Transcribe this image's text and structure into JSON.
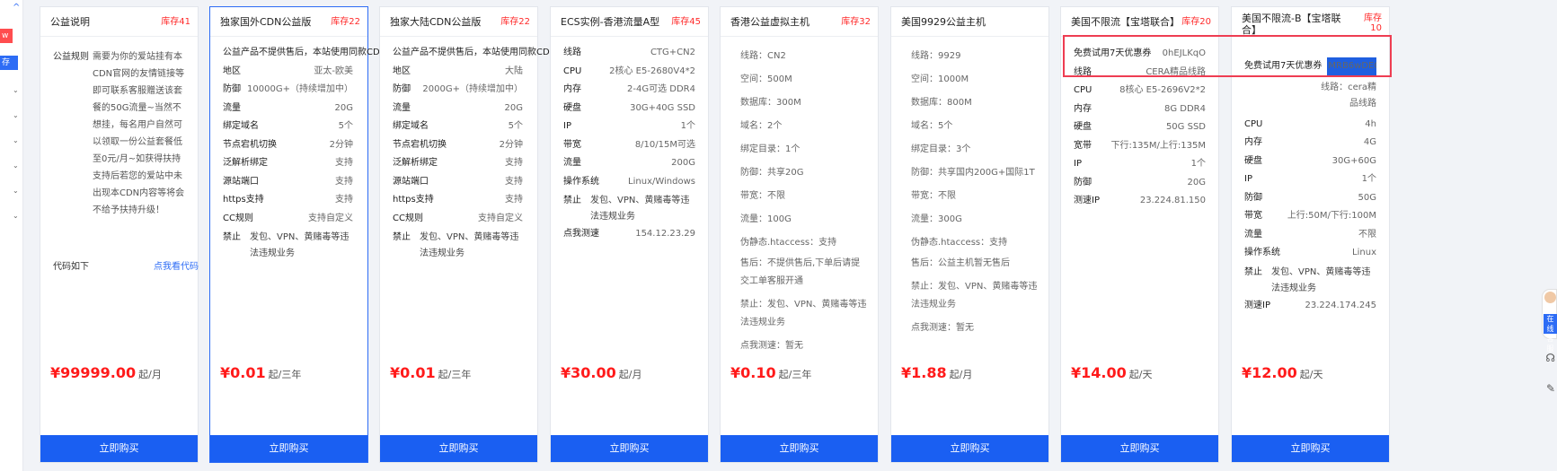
{
  "sidebar": {
    "top_label": "^",
    "tag_red": "w",
    "tag_blue": "存",
    "arrows": [
      "⌄",
      "⌄",
      "⌄",
      "⌄",
      "⌄",
      "⌄"
    ]
  },
  "cards": [
    {
      "title": "公益说明",
      "stock": "库存41",
      "price": "¥99999.00",
      "unit": "起/月",
      "buy": "立即购买",
      "note": {
        "label": "公益规则",
        "text": "需要为你的爱站挂有本CDN官网的友情链接等即可联系客服赠送该套餐的50G流量~当然不想挂，每名用户自然可以领取一份公益套餐低至0元/月~如获得扶持支持后若您的爱站中未出现本CDN内容等将会不给予扶持升级！",
        "code_label": "代码如下",
        "code_link": "点我看代码"
      }
    },
    {
      "title": "独家国外CDN公益版",
      "stock": "库存22",
      "price": "¥0.01",
      "unit": "起/三年",
      "buy": "立即购买",
      "rows": [
        [
          "公益产品不提供售后，本站使用同款CDN，",
          ""
        ],
        [
          "地区",
          "亚太-欧美"
        ],
        [
          "防御",
          "10000G+（持续增加中）"
        ],
        [
          "流量",
          "20G"
        ],
        [
          "绑定域名",
          "5个"
        ],
        [
          "节点宕机切换",
          "2分钟"
        ],
        [
          "泛解析绑定",
          "支持"
        ],
        [
          "源站端口",
          "支持"
        ],
        [
          "https支持",
          "支持"
        ],
        [
          "CC规则",
          "支持自定义"
        ]
      ],
      "wrap": {
        "k": "禁止",
        "v": "发包、VPN、黄赌毒等违法违规业务"
      }
    },
    {
      "title": "独家大陆CDN公益版",
      "stock": "库存22",
      "price": "¥0.01",
      "unit": "起/三年",
      "buy": "立即购买",
      "rows": [
        [
          "公益产品不提供售后，本站使用同款CDN，",
          ""
        ],
        [
          "地区",
          "大陆"
        ],
        [
          "防御",
          "2000G+（持续增加中）"
        ],
        [
          "流量",
          "20G"
        ],
        [
          "绑定域名",
          "5个"
        ],
        [
          "节点宕机切换",
          "2分钟"
        ],
        [
          "泛解析绑定",
          "支持"
        ],
        [
          "源站端口",
          "支持"
        ],
        [
          "https支持",
          "支持"
        ],
        [
          "CC规则",
          "支持自定义"
        ]
      ],
      "wrap": {
        "k": "禁止",
        "v": "发包、VPN、黄赌毒等违法违规业务"
      }
    },
    {
      "title": "ECS实例-香港流量A型",
      "stock": "库存45",
      "price": "¥30.00",
      "unit": "起/月",
      "buy": "立即购买",
      "rows": [
        [
          "线路",
          "CTG+CN2"
        ],
        [
          "CPU",
          "2核心 E5-2680V4*2"
        ],
        [
          "内存",
          "2-4G可选 DDR4"
        ],
        [
          "硬盘",
          "30G+40G SSD"
        ],
        [
          "IP",
          "1个"
        ],
        [
          "带宽",
          "8/10/15M可选"
        ],
        [
          "流量",
          "200G"
        ],
        [
          "操作系统",
          "Linux/Windows"
        ]
      ],
      "wrap": {
        "k": "禁止",
        "v": "发包、VPN、黄赌毒等违法违规业务"
      },
      "tail": [
        "点我测速",
        "154.12.23.29"
      ]
    },
    {
      "title": "香港公益虚拟主机",
      "stock": "库存32",
      "price": "¥0.10",
      "unit": "起/三年",
      "buy": "立即购买",
      "plain": [
        "线路：CN2",
        "空间：500M",
        "数据库：300M",
        "域名：2个",
        "绑定目录：1个",
        "防御：共享20G",
        "带宽：不限",
        "流量：100G",
        "伪静态.htaccess：支持"
      ],
      "plainw": [
        "售后：不提供售后,下单后请提交工单客服开通",
        "禁止：发包、VPN、黄赌毒等违法违规业务",
        "点我测速：暂无"
      ]
    },
    {
      "title": "美国9929公益主机",
      "stock": "",
      "price": "¥1.88",
      "unit": "起/月",
      "buy": "立即购买",
      "plain": [
        "线路：9929",
        "空间：1000M",
        "数据库：800M",
        "域名：5个",
        "绑定目录：3个",
        "防御：共享国内200G+国际1T",
        "带宽：不限",
        "流量：300G",
        "伪静态.htaccess：支持"
      ],
      "plainw": [
        "售后：公益主机暂无售后",
        "禁止：发包、VPN、黄赌毒等违法违规业务",
        "点我测速：暂无"
      ]
    },
    {
      "title": "美国不限流【宝塔联合】",
      "stock": "库存20",
      "price": "¥14.00",
      "unit": "起/天",
      "buy": "立即购买",
      "rows": [
        [
          "免费试用7天优惠券",
          "0hEJLKqO"
        ],
        [
          "线路",
          "CERA精品线路"
        ],
        [
          "CPU",
          "8核心 E5-2696V2*2"
        ],
        [
          "内存",
          "8G DDR4"
        ],
        [
          "硬盘",
          "50G SSD"
        ],
        [
          "宽带",
          "下行:135M/上行:135M"
        ],
        [
          "IP",
          "1个"
        ],
        [
          "防御",
          "20G"
        ],
        [
          "测速IP",
          "23.224.81.150"
        ]
      ]
    },
    {
      "title": "美国不限流-B【宝塔联合】",
      "stock": "库存10",
      "price": "¥12.00",
      "unit": "起/天",
      "buy": "立即购买",
      "coupon": [
        "免费试用7天优惠券",
        "MRB6wDEC"
      ],
      "line": [
        "线路：",
        "cera精品线路"
      ],
      "rows": [
        [
          "CPU",
          "4h"
        ],
        [
          "内存",
          "4G"
        ],
        [
          "硬盘",
          "30G+60G"
        ],
        [
          "IP",
          "1个"
        ],
        [
          "防御",
          "50G"
        ],
        [
          "带宽",
          "上行:50M/下行:100M"
        ],
        [
          "流量",
          "不限"
        ],
        [
          "操作系统",
          "Linux"
        ]
      ],
      "wrap": {
        "k": "禁止",
        "v": "发包、VPN、黄赌毒等违法违规业务"
      },
      "tail": [
        "测速IP",
        "23.224.174.245"
      ]
    }
  ],
  "edge": {
    "badge": "在线 客服"
  }
}
